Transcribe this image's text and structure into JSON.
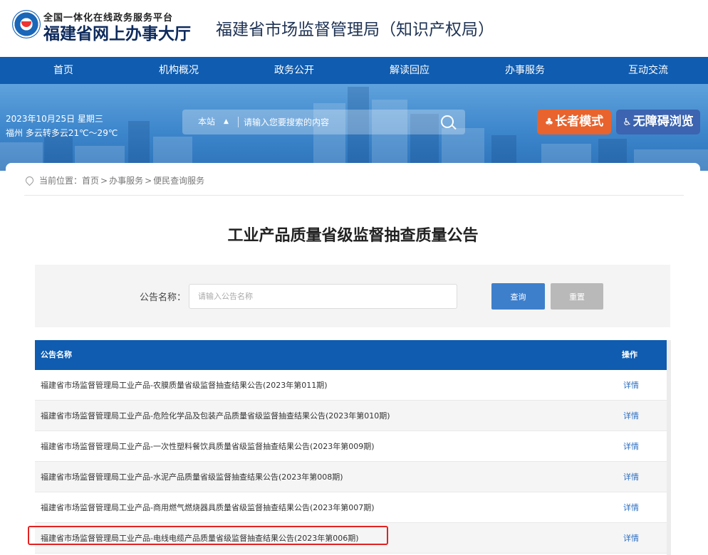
{
  "header": {
    "logo_line1": "全国一体化在线政务服务平台",
    "logo_line2": "福建省网上办事大厅",
    "site_title": "福建省市场监督管理局（知识产权局）"
  },
  "nav": {
    "items": [
      "首页",
      "机构概况",
      "政务公开",
      "解读回应",
      "办事服务",
      "互动交流"
    ]
  },
  "banner": {
    "date": "2023年10月25日 星期三",
    "weather": "福州 多云转多云21℃～29℃",
    "search_scope": "本站",
    "search_placeholder": "请输入您要搜索的内容",
    "elder_mode_label": "长者模式",
    "accessibility_label": "无障碍浏览"
  },
  "breadcrumb": {
    "prefix": "当前位置：",
    "items": [
      "首页",
      "办事服务",
      "便民查询服务"
    ],
    "separator": ">"
  },
  "page_title": "工业产品质量省级监督抽查质量公告",
  "filter": {
    "label": "公告名称：",
    "placeholder": "请输入公告名称",
    "query_label": "查询",
    "reset_label": "重置"
  },
  "table": {
    "columns": [
      "公告名称",
      "操作"
    ],
    "action_label": "详情",
    "rows": [
      "福建省市场监督管理局工业产品-农膜质量省级监督抽查结果公告(2023年第011期)",
      "福建省市场监督管理局工业产品-危险化学品及包装产品质量省级监督抽查结果公告(2023年第010期)",
      "福建省市场监督管理局工业产品-一次性塑料餐饮具质量省级监督抽查结果公告(2023年第009期)",
      "福建省市场监督管理局工业产品-水泥产品质量省级监督抽查结果公告(2023年第008期)",
      "福建省市场监督管理局工业产品-商用燃气燃烧器具质量省级监督抽查结果公告(2023年第007期)",
      "福建省市场监督管理局工业产品-电线电缆产品质量省级监督抽查结果公告(2023年第006期)"
    ]
  },
  "colors": {
    "primary_blue": "#0f5cb0",
    "elder_orange": "#e8632d",
    "access_blue": "#3c64b0",
    "link_blue": "#2a6ec2",
    "highlight_red": "#e22222"
  }
}
